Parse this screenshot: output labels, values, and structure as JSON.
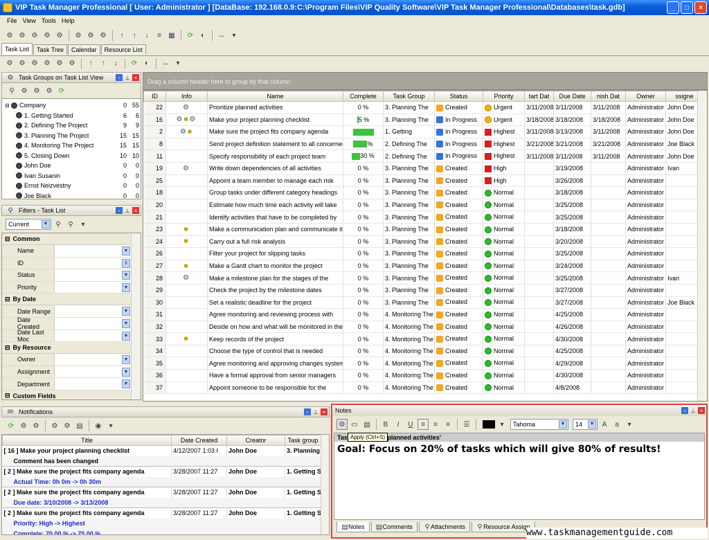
{
  "window": {
    "title": "VIP Task Manager Professional [ User: Administrator ] [DataBase: 192.168.0.9:C:\\Program Files\\VIP Quality Software\\VIP Task Manager Professional\\Databases\\task.gdb]"
  },
  "menu": [
    "File",
    "View",
    "Tools",
    "Help"
  ],
  "tabs": [
    "Task List",
    "Task Tree",
    "Calendar",
    "Resource List"
  ],
  "groups_panel": {
    "title": "Task Groups on Task List View",
    "items": [
      {
        "label": "Company",
        "a": "0",
        "b": "55",
        "level": 0
      },
      {
        "label": "1. Getting Started",
        "a": "6",
        "b": "6",
        "level": 1
      },
      {
        "label": "2. Defining The Project",
        "a": "9",
        "b": "9",
        "level": 1
      },
      {
        "label": "3. Planning The Project",
        "a": "15",
        "b": "15",
        "level": 1
      },
      {
        "label": "4. Monitoring The Project",
        "a": "15",
        "b": "15",
        "level": 1
      },
      {
        "label": "5. Closing Down",
        "a": "10",
        "b": "10",
        "level": 1
      },
      {
        "label": "John Doe",
        "a": "0",
        "b": "0",
        "level": 1
      },
      {
        "label": "Ivan Susanin",
        "a": "0",
        "b": "0",
        "level": 1
      },
      {
        "label": "Ernst Neizvestny",
        "a": "0",
        "b": "0",
        "level": 1
      },
      {
        "label": "Joe Black",
        "a": "0",
        "b": "0",
        "level": 1
      }
    ]
  },
  "filters_panel": {
    "title": "Filters - Task List",
    "current": "Current",
    "groups": [
      {
        "name": "Common",
        "fields": [
          "Name",
          "ID",
          "Status",
          "Priority"
        ]
      },
      {
        "name": "By Date",
        "fields": [
          "Date Range",
          "Date Created",
          "Date Last Moc"
        ]
      },
      {
        "name": "By Resource",
        "fields": [
          "Owner",
          "Assignment",
          "Department"
        ]
      },
      {
        "name": "Custom Fields",
        "fields": []
      }
    ]
  },
  "task_grid": {
    "group_hint": "Drag a column header here to group by that column",
    "columns": [
      "ID",
      "Info",
      "Name",
      "Complete",
      "Task Group",
      "Status",
      "Priority",
      "tart Dat",
      "Due Date",
      "nish Dat",
      "Owner",
      "ssigne"
    ],
    "rows": [
      {
        "id": "22",
        "name": "Prioritize planned activities",
        "complete": "0 %",
        "group": "3. Planning The",
        "status": "Created",
        "priority": "Urgent",
        "start": "3/11/2008",
        "due": "3/11/2008",
        "finish": "3/11/2008",
        "owner": "Administrator",
        "assignee": "John Doe"
      },
      {
        "id": "16",
        "name": "Make your project planning checklist",
        "complete": "5 %",
        "group": "3. Planning The",
        "status": "In Progress",
        "priority": "Urgent",
        "start": "3/18/2008",
        "due": "3/18/2008",
        "finish": "3/18/2008",
        "owner": "Administrator",
        "assignee": "John Doe"
      },
      {
        "id": "2",
        "name": "Make sure the project fits company agenda",
        "complete": "",
        "group": "1. Getting",
        "status": "In Progress",
        "priority": "Highest",
        "start": "3/11/2008",
        "due": "3/13/2008",
        "finish": "3/11/2008",
        "owner": "Administrator",
        "assignee": "John Doe"
      },
      {
        "id": "8",
        "name": "Send project definition statement to all concerned",
        "complete": "%",
        "group": "2. Defining The",
        "status": "In Progress",
        "priority": "Highest",
        "start": "3/21/2008",
        "due": "3/21/2008",
        "finish": "3/21/2008",
        "owner": "Administrator",
        "assignee": "Joe Black"
      },
      {
        "id": "11",
        "name": "Specify responsibility of each project team",
        "complete": "30 %",
        "group": "2. Defining The",
        "status": "In Progress",
        "priority": "Highest",
        "start": "3/11/2008",
        "due": "3/11/2008",
        "finish": "3/11/2008",
        "owner": "Administrator",
        "assignee": "John Doe"
      },
      {
        "id": "19",
        "name": "Write down dependencies of all activities",
        "complete": "0 %",
        "group": "3. Planning The",
        "status": "Created",
        "priority": "High",
        "start": "",
        "due": "3/19/2008",
        "finish": "",
        "owner": "Administrator",
        "assignee": "Ivan"
      },
      {
        "id": "25",
        "name": "Appoint a team member to manage each risk",
        "complete": "0 %",
        "group": "3. Planning The",
        "status": "Created",
        "priority": "High",
        "start": "",
        "due": "3/26/2008",
        "finish": "",
        "owner": "Administrator",
        "assignee": ""
      },
      {
        "id": "18",
        "name": "Group tasks under different category headings",
        "complete": "0 %",
        "group": "3. Planning The",
        "status": "Created",
        "priority": "Normal",
        "start": "",
        "due": "3/18/2008",
        "finish": "",
        "owner": "Administrator",
        "assignee": ""
      },
      {
        "id": "20",
        "name": "Estimate how much time each activity will take",
        "complete": "0 %",
        "group": "3. Planning The",
        "status": "Created",
        "priority": "Normal",
        "start": "",
        "due": "3/25/2008",
        "finish": "",
        "owner": "Administrator",
        "assignee": ""
      },
      {
        "id": "21",
        "name": "Identify activities that have to be completed by",
        "complete": "0 %",
        "group": "3. Planning The",
        "status": "Created",
        "priority": "Normal",
        "start": "",
        "due": "3/25/2008",
        "finish": "",
        "owner": "Administrator",
        "assignee": ""
      },
      {
        "id": "23",
        "name": "Make a communication plan and communicate it",
        "complete": "0 %",
        "group": "3. Planning The",
        "status": "Created",
        "priority": "Normal",
        "start": "",
        "due": "3/18/2008",
        "finish": "",
        "owner": "Administrator",
        "assignee": ""
      },
      {
        "id": "24",
        "name": "Carry out a full risk analysis",
        "complete": "0 %",
        "group": "3. Planning The",
        "status": "Created",
        "priority": "Normal",
        "start": "",
        "due": "3/20/2008",
        "finish": "",
        "owner": "Administrator",
        "assignee": ""
      },
      {
        "id": "26",
        "name": "Filter your project for slipping tasks",
        "complete": "0 %",
        "group": "3. Planning The",
        "status": "Created",
        "priority": "Normal",
        "start": "",
        "due": "3/25/2008",
        "finish": "",
        "owner": "Administrator",
        "assignee": ""
      },
      {
        "id": "27",
        "name": "Make a Gantt chart to monitor the project",
        "complete": "0 %",
        "group": "3. Planning The",
        "status": "Created",
        "priority": "Normal",
        "start": "",
        "due": "3/24/2008",
        "finish": "",
        "owner": "Administrator",
        "assignee": ""
      },
      {
        "id": "28",
        "name": "Make a milestone plan for the stages of the",
        "complete": "0 %",
        "group": "3. Planning The",
        "status": "Created",
        "priority": "Normal",
        "start": "",
        "due": "3/25/2008",
        "finish": "",
        "owner": "Administrator",
        "assignee": "Ivan"
      },
      {
        "id": "29",
        "name": "Check the project by the milestone dates",
        "complete": "0 %",
        "group": "3. Planning The",
        "status": "Created",
        "priority": "Normal",
        "start": "",
        "due": "3/27/2008",
        "finish": "",
        "owner": "Administrator",
        "assignee": ""
      },
      {
        "id": "30",
        "name": "Set a realistic deadline for the project",
        "complete": "0 %",
        "group": "3. Planning The",
        "status": "Created",
        "priority": "Normal",
        "start": "",
        "due": "3/27/2008",
        "finish": "",
        "owner": "Administrator",
        "assignee": "Joe Black"
      },
      {
        "id": "31",
        "name": "Agree monitoring and reviewing process with",
        "complete": "0 %",
        "group": "4. Monitoring The",
        "status": "Created",
        "priority": "Normal",
        "start": "",
        "due": "4/25/2008",
        "finish": "",
        "owner": "Administrator",
        "assignee": ""
      },
      {
        "id": "32",
        "name": "Deside on how and what will be monitored in the",
        "complete": "0 %",
        "group": "4. Monitoring The",
        "status": "Created",
        "priority": "Normal",
        "start": "",
        "due": "4/26/2008",
        "finish": "",
        "owner": "Administrator",
        "assignee": ""
      },
      {
        "id": "33",
        "name": "Keep records of the project",
        "complete": "0 %",
        "group": "4. Monitoring The",
        "status": "Created",
        "priority": "Normal",
        "start": "",
        "due": "4/30/2008",
        "finish": "",
        "owner": "Administrator",
        "assignee": ""
      },
      {
        "id": "34",
        "name": "Choose the type of control that is needed",
        "complete": "0 %",
        "group": "4. Monitoring The",
        "status": "Created",
        "priority": "Normal",
        "start": "",
        "due": "4/25/2008",
        "finish": "",
        "owner": "Administrator",
        "assignee": ""
      },
      {
        "id": "35",
        "name": "Agree monitoring and approving changes system",
        "complete": "0 %",
        "group": "4. Monitoring The",
        "status": "Created",
        "priority": "Normal",
        "start": "",
        "due": "4/29/2008",
        "finish": "",
        "owner": "Administrator",
        "assignee": ""
      },
      {
        "id": "36",
        "name": "Have a formal approval from senior managers",
        "complete": "0 %",
        "group": "4. Monitoring The",
        "status": "Created",
        "priority": "Normal",
        "start": "",
        "due": "4/30/2008",
        "finish": "",
        "owner": "Administrator",
        "assignee": ""
      },
      {
        "id": "37",
        "name": "Appoint someone to be responsible for the",
        "complete": "0 %",
        "group": "4. Monitoring The",
        "status": "Created",
        "priority": "Normal",
        "start": "",
        "due": "4/8/2008",
        "finish": "",
        "owner": "Administrator",
        "assignee": ""
      }
    ]
  },
  "notifications": {
    "title": "Notifications",
    "columns": [
      "Title",
      "Date Created",
      "Creator",
      "Task group"
    ],
    "rows": [
      {
        "type": "main",
        "title": "[ 16 ] Make your project planning checklist",
        "date": "4/12/2007 1:03 I",
        "creator": "John Doe",
        "group": "3. Planning"
      },
      {
        "type": "sub",
        "title": "Comment has been changed"
      },
      {
        "type": "main",
        "title": "[ 2 ] Make sure the project fits company agenda",
        "date": "3/28/2007 11:27",
        "creator": "John Doe",
        "group": "1. Getting S"
      },
      {
        "type": "detail",
        "title": "Actual Time: 0h 0m -> 0h 30m"
      },
      {
        "type": "main",
        "title": "[ 2 ] Make sure the project fits company agenda",
        "date": "3/28/2007 11:27",
        "creator": "John Doe",
        "group": "1. Getting S"
      },
      {
        "type": "detail",
        "title": "Due date: 3/10/2008 -> 3/13/2008"
      },
      {
        "type": "main",
        "title": "[ 2 ] Make sure the project fits company agenda",
        "date": "3/28/2007 11:27",
        "creator": "John Doe",
        "group": "1. Getting S"
      },
      {
        "type": "detail",
        "title": "Priority: High -> Highest"
      },
      {
        "type": "detail",
        "title": "Complete: 70.00 % -> 75.00 %"
      }
    ]
  },
  "notes": {
    "title": "Notes",
    "font": "Tahoma",
    "size": "14",
    "tooltip": "Apply (Ctrl+S)",
    "header_line": "Tas",
    "header_line2": "ritize planned activities'",
    "body": "Goal: Focus on 20% of tasks which will give 80% of results!",
    "tabs": [
      "Notes",
      "Comments",
      "Attachments",
      "Resource Assign"
    ]
  },
  "watermark": "www.taskmanagementguide.com",
  "colors": {
    "accent": "#0553c9",
    "notes_border": "#d44444",
    "progress": "#3cc43c"
  }
}
